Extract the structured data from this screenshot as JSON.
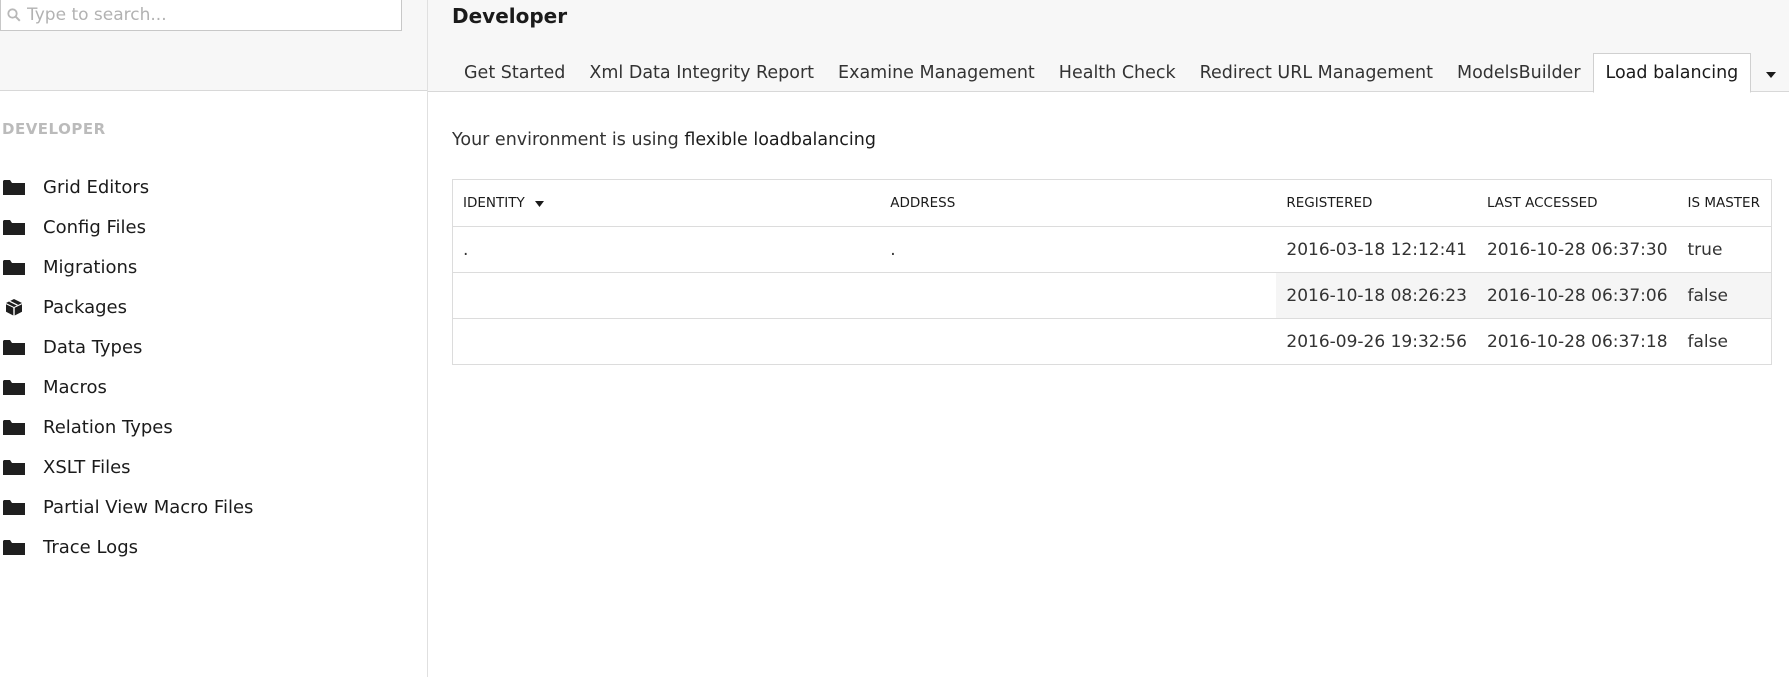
{
  "search": {
    "placeholder": "Type to search..."
  },
  "sidebar": {
    "section_title": "DEVELOPER",
    "items": [
      {
        "label": "Grid Editors",
        "icon": "folder-icon"
      },
      {
        "label": "Config Files",
        "icon": "folder-icon"
      },
      {
        "label": "Migrations",
        "icon": "folder-icon"
      },
      {
        "label": "Packages",
        "icon": "package-icon"
      },
      {
        "label": "Data Types",
        "icon": "folder-icon"
      },
      {
        "label": "Macros",
        "icon": "folder-icon"
      },
      {
        "label": "Relation Types",
        "icon": "folder-icon"
      },
      {
        "label": "XSLT Files",
        "icon": "folder-icon"
      },
      {
        "label": "Partial View Macro Files",
        "icon": "folder-icon"
      },
      {
        "label": "Trace Logs",
        "icon": "folder-icon"
      }
    ]
  },
  "header": {
    "title": "Developer",
    "tabs": [
      {
        "label": "Get Started"
      },
      {
        "label": "Xml Data Integrity Report"
      },
      {
        "label": "Examine Management"
      },
      {
        "label": "Health Check"
      },
      {
        "label": "Redirect URL Management"
      },
      {
        "label": "ModelsBuilder"
      },
      {
        "label": "Load balancing",
        "active": true
      }
    ],
    "more_icon": "caret-down-icon"
  },
  "content": {
    "env_prefix": "Your environment is using",
    "env_mode": "flexible loadbalancing"
  },
  "table": {
    "columns": {
      "identity": "IDENTITY",
      "address": "ADDRESS",
      "registered": "REGISTERED",
      "last_accessed": "LAST ACCESSED",
      "is_master": "IS MASTER"
    },
    "rows": [
      {
        "identity": ".",
        "address": ".",
        "registered": "2016-03-18 12:12:41",
        "last_accessed": "2016-10-28 06:37:30",
        "is_master": "true"
      },
      {
        "identity": "",
        "address": "",
        "registered": "2016-10-18 08:26:23",
        "last_accessed": "2016-10-28 06:37:06",
        "is_master": "false"
      },
      {
        "identity": "",
        "address": "",
        "registered": "2016-09-26 19:32:56",
        "last_accessed": "2016-10-28 06:37:18",
        "is_master": "false"
      }
    ]
  },
  "colors": {
    "text": "#1b1b1b",
    "muted": "#bbbbbb",
    "border": "#dcdcdc",
    "header_bg": "#f7f7f7"
  }
}
